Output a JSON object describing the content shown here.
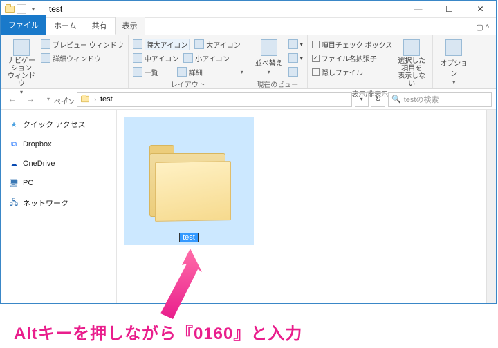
{
  "title": {
    "sep": "|",
    "text": "test"
  },
  "wincontrols": {
    "min": "—",
    "max": "☐",
    "close": "✕"
  },
  "tabs": {
    "file": "ファイル",
    "home": "ホーム",
    "share": "共有",
    "view": "表示"
  },
  "ribbon": {
    "pane": {
      "nav": "ナビゲーション\nウィンドウ",
      "preview": "プレビュー ウィンドウ",
      "details": "詳細ウィンドウ",
      "label": "ペイン"
    },
    "layout": {
      "r1a": "特大アイコン",
      "r1b": "大アイコン",
      "r2a": "中アイコン",
      "r2b": "小アイコン",
      "r3a": "一覧",
      "r3b": "詳細",
      "label": "レイアウト"
    },
    "sort": {
      "btn": "並べ替え",
      "label": "現在のビュー"
    },
    "showhide": {
      "c1": "項目チェック ボックス",
      "c2": "ファイル名拡張子",
      "c3": "隠しファイル",
      "hidebtn": "選択した項目を\n表示しない",
      "label": "表示/非表示"
    },
    "options": {
      "btn": "オプション"
    }
  },
  "address": {
    "crumb": "test",
    "refresh": "↻"
  },
  "search": {
    "placeholder": "testの検索"
  },
  "sidebar": {
    "quick": "クイック アクセス",
    "dropbox": "Dropbox",
    "onedrive": "OneDrive",
    "pc": "PC",
    "network": "ネットワーク"
  },
  "folder": {
    "rename_value": "test"
  },
  "annotation": "Altキーを押しながら『0160』と入力"
}
